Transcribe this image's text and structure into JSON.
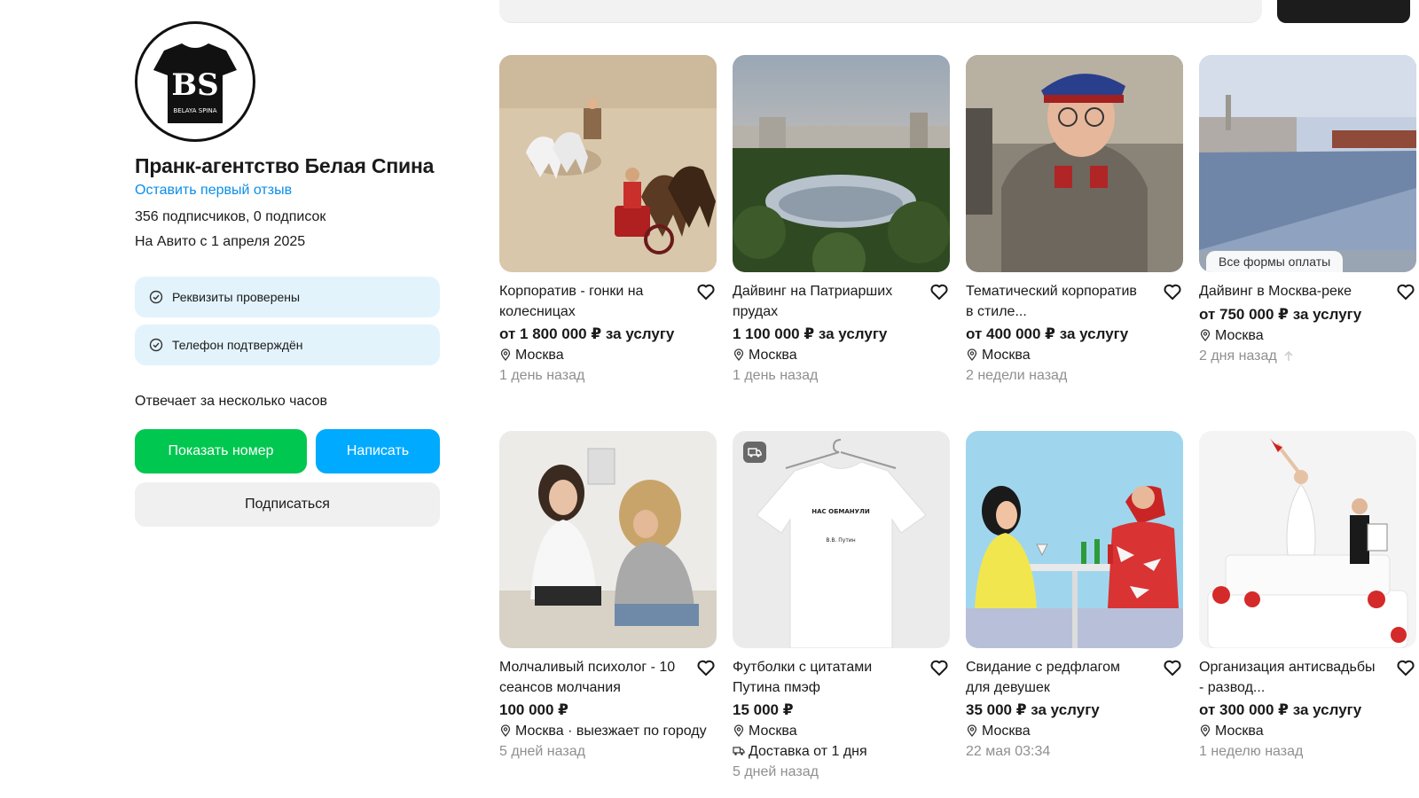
{
  "seller": {
    "name": "Пранк-агентство Белая Спина",
    "logo_text": "BS",
    "logo_subtext": "BELAYA SPINA",
    "review_link": "Оставить первый отзыв",
    "subscribers": "356 подписчиков, 0 подписок",
    "since": "На Авито с 1 апреля 2025",
    "badges": [
      "Реквизиты проверены",
      "Телефон подтверждён"
    ],
    "response_time": "Отвечает за несколько часов",
    "show_phone_label": "Показать номер",
    "write_label": "Написать",
    "subscribe_label": "Подписаться"
  },
  "listings": [
    {
      "title": "Корпоратив - гонки на колесницах",
      "price": "от 1 800 000 ₽ за услугу",
      "location": "Москва",
      "date": "1 день назад",
      "image": "chariot-race-photo"
    },
    {
      "title": "Дайвинг на Патриарших прудах",
      "price": "1 100 000 ₽ за услугу",
      "location": "Москва",
      "date": "1 день назад",
      "image": "patriarch-ponds-photo"
    },
    {
      "title": "Тематический корпоратив в стиле...",
      "price": "от 400 000 ₽ за услугу",
      "location": "Москва",
      "date": "2 недели назад",
      "image": "soviet-officer-photo"
    },
    {
      "title": "Дайвинг в Москва-реке",
      "price": "от 750 000 ₽ за услугу",
      "location": "Москва",
      "date": "2 дня назад",
      "image": "moscow-river-photo",
      "payment_badge": "Все формы оплаты"
    },
    {
      "title": "Молчаливый психолог - 10 сеансов молчания",
      "price": "100 000 ₽",
      "location": "Москва · выезжает по городу",
      "date": "5 дней назад",
      "image": "psychologist-photo"
    },
    {
      "title": "Футболки с цитатами Путина пмэф",
      "price": "15 000 ₽",
      "location": "Москва",
      "delivery": "Доставка от 1 дня",
      "date": "5 дней назад",
      "image": "tshirt-photo",
      "tshirt_line1": "НАС ОБМАНУЛИ",
      "tshirt_line2": "В.В. Путин"
    },
    {
      "title": "Свидание с редфлагом для девушек",
      "price": "35 000 ₽ за услугу",
      "location": "Москва",
      "date": "22 мая 03:34",
      "image": "redflag-date-illustration"
    },
    {
      "title": "Организация антисвадьбы - развод...",
      "price": "от 300 000 ₽ за услугу",
      "location": "Москва",
      "date": "1 неделю назад",
      "image": "wedding-cake-photo"
    }
  ]
}
